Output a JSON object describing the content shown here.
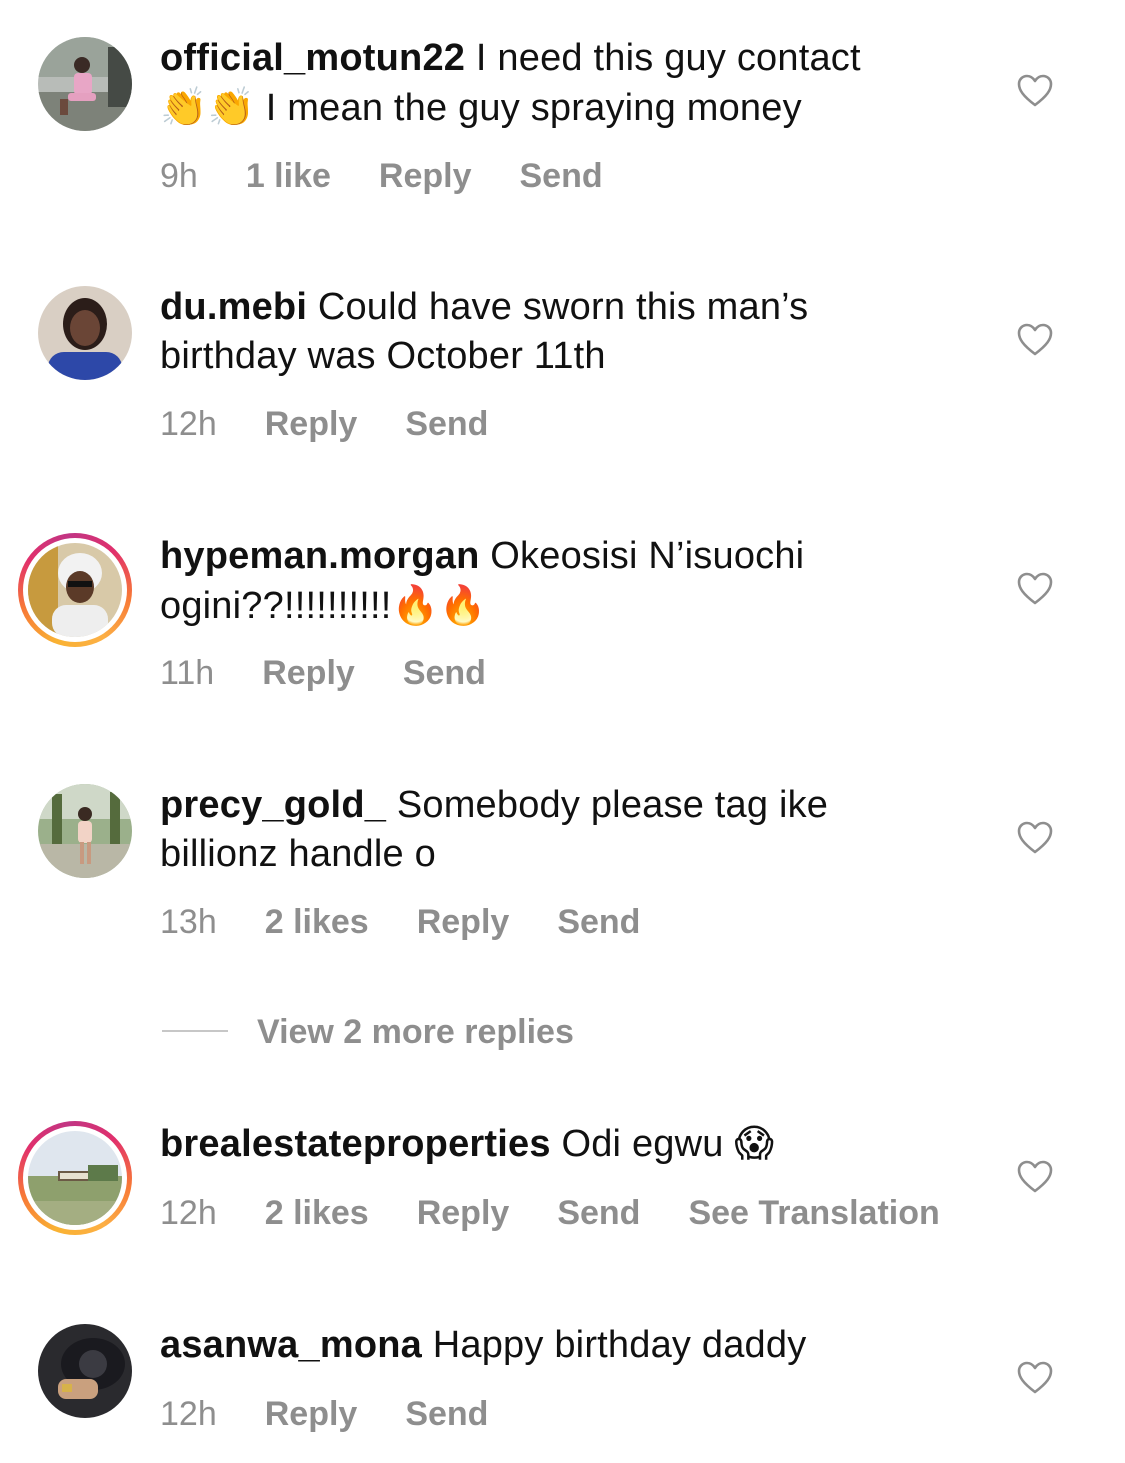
{
  "comments": [
    {
      "username": "official_motun22",
      "text_line1": " I need this guy contact",
      "text_line2_prefix_emoji": "👏👏",
      "text_line2": " I mean the guy spraying money",
      "time": "9h",
      "likes": "1 like",
      "reply": "Reply",
      "send": "Send",
      "story_ring": false
    },
    {
      "username": "du.mebi",
      "text_line1": " Could have sworn this man’s",
      "text_line2": "birthday was October 11th",
      "time": "12h",
      "reply": "Reply",
      "send": "Send",
      "story_ring": false
    },
    {
      "username": "hypeman.morgan",
      "text_line1": " Okeosisi N’isuochi",
      "text_line2": "ogini??!!!!!!!!!!",
      "text_line2_suffix_emoji": "🔥🔥",
      "time": "11h",
      "reply": "Reply",
      "send": "Send",
      "story_ring": true
    },
    {
      "username": "precy_gold_",
      "text_line1": " Somebody please tag ike",
      "text_line2": "billionz handle o",
      "time": "13h",
      "likes": "2 likes",
      "reply": "Reply",
      "send": "Send",
      "story_ring": false
    },
    {
      "username": "brealestateproperties",
      "text_line1": " Odi egwu",
      "text_line1_suffix_emoji": "😱",
      "time": "12h",
      "likes": "2 likes",
      "reply": "Reply",
      "send": "Send",
      "translation": "See Translation",
      "story_ring": true
    },
    {
      "username": "asanwa_mona",
      "text_line1": " Happy birthday daddy",
      "time": "12h",
      "reply": "Reply",
      "send": "Send",
      "story_ring": false
    }
  ],
  "view_more_replies": "View 2 more replies",
  "icons": {
    "like": "heart-outline-icon"
  },
  "colors": {
    "meta_text": "#8e8e8e",
    "story_ring_start": "#f9b233",
    "story_ring_end": "#c13584"
  }
}
